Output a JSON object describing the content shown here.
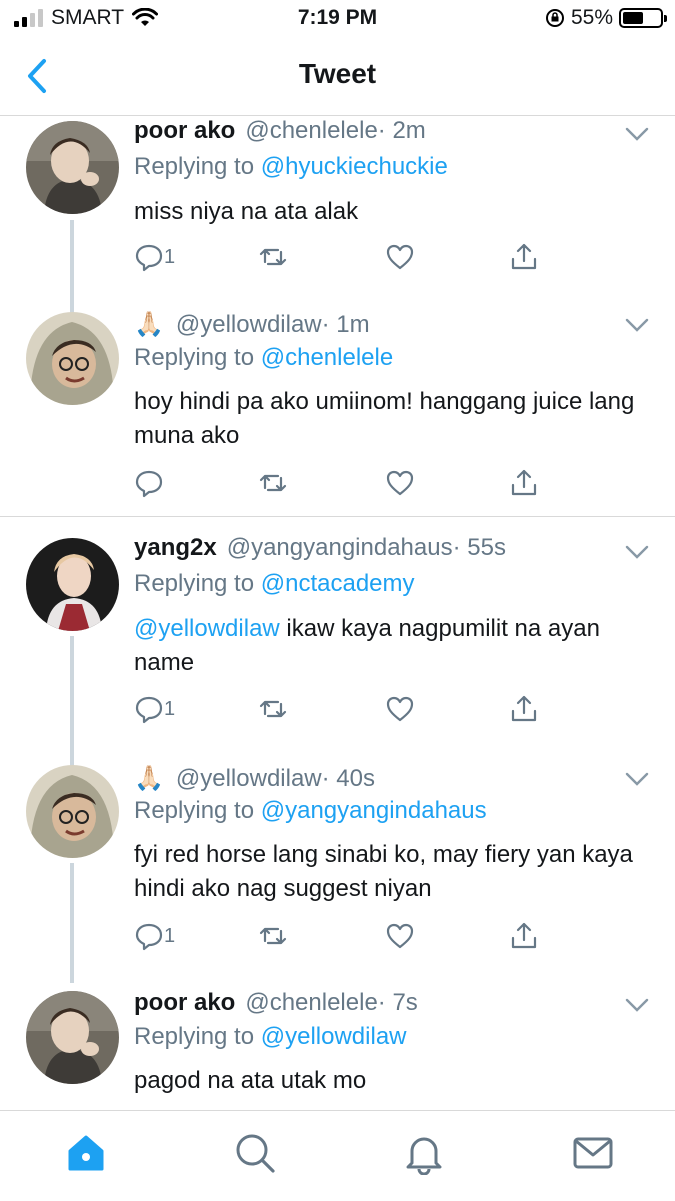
{
  "status_bar": {
    "carrier": "SMART",
    "time": "7:19 PM",
    "battery": "55%",
    "battery_level": 0.55
  },
  "nav": {
    "title": "Tweet",
    "back_icon": "chevron-left-icon"
  },
  "colors": {
    "accent": "#1da1f2",
    "secondary_text": "#657786",
    "divider": "#d9d9d9",
    "thread_line": "#ccd6dd"
  },
  "tweets": [
    {
      "name": "poor ako",
      "handle": "@chenlelele",
      "time": "· 2m",
      "replying_prefix": "Replying to",
      "replying_to": "@hyuckiechuckie",
      "text": "miss niya na ata alak",
      "reply_count": "1"
    },
    {
      "name_emoji": "🙏🏻",
      "handle": "@yellowdilaw",
      "time": "· 1m",
      "replying_prefix": "Replying to",
      "replying_to": "@chenlelele",
      "text": "hoy hindi pa ako umiinom! hanggang juice lang muna ako",
      "reply_count": ""
    },
    {
      "name": "yang2x",
      "handle": "@yangyangindahaus",
      "time": "· 55s",
      "replying_prefix": "Replying to",
      "replying_to": "@nctacademy",
      "text_mention": "@yellowdilaw",
      "text": " ikaw kaya nagpumilit na ayan name",
      "reply_count": "1"
    },
    {
      "name_emoji": "🙏🏻",
      "handle": "@yellowdilaw",
      "time": "· 40s",
      "replying_prefix": "Replying to",
      "replying_to": "@yangyangindahaus",
      "text": "fyi red horse lang sinabi ko, may fiery yan kaya hindi ako nag suggest niyan",
      "reply_count": "1"
    },
    {
      "name": "poor ako",
      "handle": "@chenlelele",
      "time": "· 7s",
      "replying_prefix": "Replying to",
      "replying_to": "@yellowdilaw",
      "text": "pagod na ata utak mo"
    }
  ],
  "tab_bar": {
    "items": [
      "home-icon",
      "search-icon",
      "notifications-icon",
      "messages-icon"
    ],
    "active": "home-icon"
  }
}
